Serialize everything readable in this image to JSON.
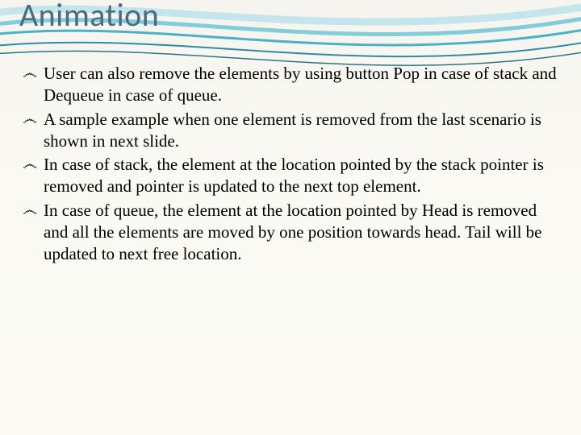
{
  "slide": {
    "title": "Animation",
    "bullets": [
      "User can also remove the elements by using button Pop in case of stack and Dequeue in case of queue.",
      "A sample example when one element is removed from the last scenario is shown in next slide.",
      "In case of stack, the element at the location pointed by the stack pointer is removed and pointer is updated to the next top element.",
      "In case of queue, the element at the location pointed by Head is removed and all the elements are moved by one position towards head. Tail will be updated to next free location."
    ],
    "bullet_marker": "་"
  },
  "theme": {
    "title_color": "#4a6a82",
    "wave_colors": [
      "#6fc4d6",
      "#3aa8c1",
      "#1b7f9a"
    ],
    "background": "#faf9f4"
  }
}
